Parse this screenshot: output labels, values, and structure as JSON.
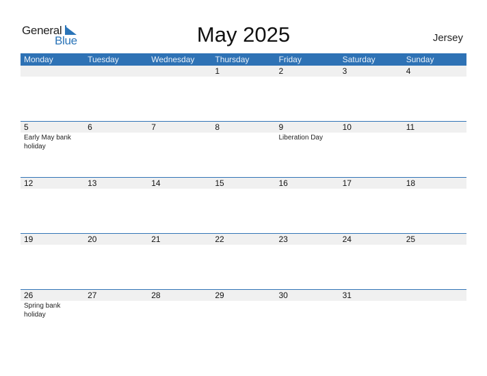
{
  "logo": {
    "word1": "General",
    "word2": "Blue"
  },
  "title": "May 2025",
  "region": "Jersey",
  "colors": {
    "header_bg": "#2e72b5",
    "date_band": "#f0f0f0",
    "accent": "#2a74b8"
  },
  "weekdays": [
    "Monday",
    "Tuesday",
    "Wednesday",
    "Thursday",
    "Friday",
    "Saturday",
    "Sunday"
  ],
  "weeks": [
    [
      {
        "day": ""
      },
      {
        "day": ""
      },
      {
        "day": ""
      },
      {
        "day": "1"
      },
      {
        "day": "2"
      },
      {
        "day": "3"
      },
      {
        "day": "4"
      }
    ],
    [
      {
        "day": "5",
        "event": "Early May bank holiday"
      },
      {
        "day": "6"
      },
      {
        "day": "7"
      },
      {
        "day": "8"
      },
      {
        "day": "9",
        "event": "Liberation Day"
      },
      {
        "day": "10"
      },
      {
        "day": "11"
      }
    ],
    [
      {
        "day": "12"
      },
      {
        "day": "13"
      },
      {
        "day": "14"
      },
      {
        "day": "15"
      },
      {
        "day": "16"
      },
      {
        "day": "17"
      },
      {
        "day": "18"
      }
    ],
    [
      {
        "day": "19"
      },
      {
        "day": "20"
      },
      {
        "day": "21"
      },
      {
        "day": "22"
      },
      {
        "day": "23"
      },
      {
        "day": "24"
      },
      {
        "day": "25"
      }
    ],
    [
      {
        "day": "26",
        "event": "Spring bank holiday"
      },
      {
        "day": "27"
      },
      {
        "day": "28"
      },
      {
        "day": "29"
      },
      {
        "day": "30"
      },
      {
        "day": "31"
      },
      {
        "day": ""
      }
    ]
  ]
}
